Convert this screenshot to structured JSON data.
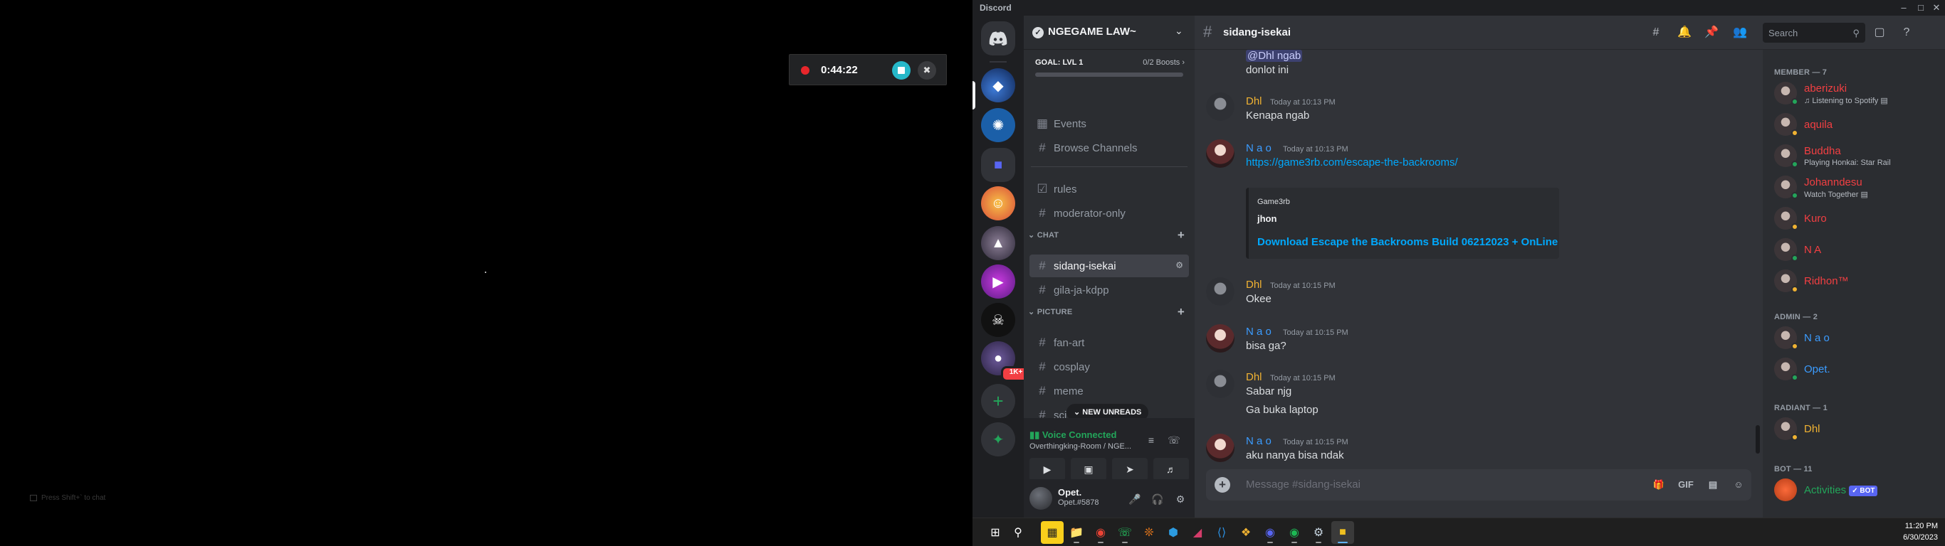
{
  "window": {
    "title": "Discord"
  },
  "recorder": {
    "time": "0:44:22"
  },
  "left_hint": "Press Shift+` to chat",
  "guild": {
    "name": "NGEGAME LAW~",
    "boost_goal": "GOAL: LVL 1",
    "boost_count": "0/2 Boosts",
    "boost_progress": 0,
    "top_items": [
      "Events",
      "Browse Channels"
    ],
    "channels": [
      "rules",
      "moderator-only"
    ],
    "categories": [
      {
        "name": "CHAT",
        "channels": [
          "sidang-isekai",
          "gila-ja-kdpp"
        ]
      },
      {
        "name": "PICTURE",
        "channels": [
          "fan-art",
          "cosplay",
          "meme",
          "sci"
        ]
      }
    ],
    "new_unreads": "NEW UNREADS"
  },
  "server_badge": "1K+",
  "voice": {
    "status": "Voice Connected",
    "channel": "Overthingking-Room / NGE..."
  },
  "user": {
    "name": "Opet.",
    "tag": "Opet.#5878"
  },
  "chat": {
    "channel": "sidang-isekai",
    "search_placeholder": "Search",
    "composer_placeholder": "Message #sidang-isekai",
    "messages": [
      {
        "author": "",
        "time": "",
        "lines": [
          "@Dhl ngab",
          "donlot ini"
        ]
      },
      {
        "author": "Dhl",
        "time": "Today at 10:13 PM",
        "lines": [
          "Kenapa ngab"
        ]
      },
      {
        "author": "N a o",
        "time": "Today at 10:13 PM",
        "lines": [
          "https://game3rb.com/escape-the-backrooms/"
        ]
      },
      {
        "author": "Dhl",
        "time": "Today at 10:15 PM",
        "lines": [
          "Okee"
        ]
      },
      {
        "author": "N a o",
        "time": "Today at 10:15 PM",
        "lines": [
          "bisa ga?"
        ]
      },
      {
        "author": "Dhl",
        "time": "Today at 10:15 PM",
        "lines": [
          "Sabar njg",
          "Ga buka laptop"
        ]
      },
      {
        "author": "N a o",
        "time": "Today at 10:15 PM",
        "lines": [
          "aku nanya bisa ndak"
        ]
      }
    ],
    "embed": {
      "provider": "Game3rb",
      "author": "jhon",
      "title": "Download Escape the Backrooms Build 06212023 + OnLine"
    }
  },
  "members": {
    "groups": [
      {
        "label": "MEMBER — 7",
        "items": [
          {
            "name": "aberizuki",
            "sub": "Listening to Spotify",
            "color": "#f23f42"
          },
          {
            "name": "aquila",
            "sub": "",
            "color": "#f23f42"
          },
          {
            "name": "Buddha",
            "sub": "Playing Honkai: Star Rail",
            "color": "#f23f42"
          },
          {
            "name": "Johanndesu",
            "sub": "Watch Together",
            "color": "#f23f42"
          },
          {
            "name": "Kuro",
            "sub": "",
            "color": "#f23f42"
          },
          {
            "name": "N A",
            "sub": "",
            "color": "#f23f42"
          },
          {
            "name": "Ridhon™",
            "sub": "",
            "color": "#f23f42"
          }
        ]
      },
      {
        "label": "ADMIN — 2",
        "items": [
          {
            "name": "N a o",
            "sub": "",
            "color": "#3b9cff"
          },
          {
            "name": "Opet.",
            "sub": "",
            "color": "#3b9cff"
          }
        ]
      },
      {
        "label": "RADIANT — 1",
        "items": [
          {
            "name": "Dhl",
            "sub": "",
            "color": "#f0b232"
          }
        ]
      },
      {
        "label": "BOT — 11",
        "items": [
          {
            "name": "Activities",
            "sub": "",
            "color": "#23a55a",
            "bot": "✓ BOT"
          }
        ]
      }
    ]
  },
  "colors": {
    "dhl": "#f0b232",
    "nao": "#3b9cff",
    "online": "#23a55a",
    "idle": "#f0b232"
  },
  "clock": {
    "time": "11:20 PM",
    "date": "6/30/2023"
  }
}
